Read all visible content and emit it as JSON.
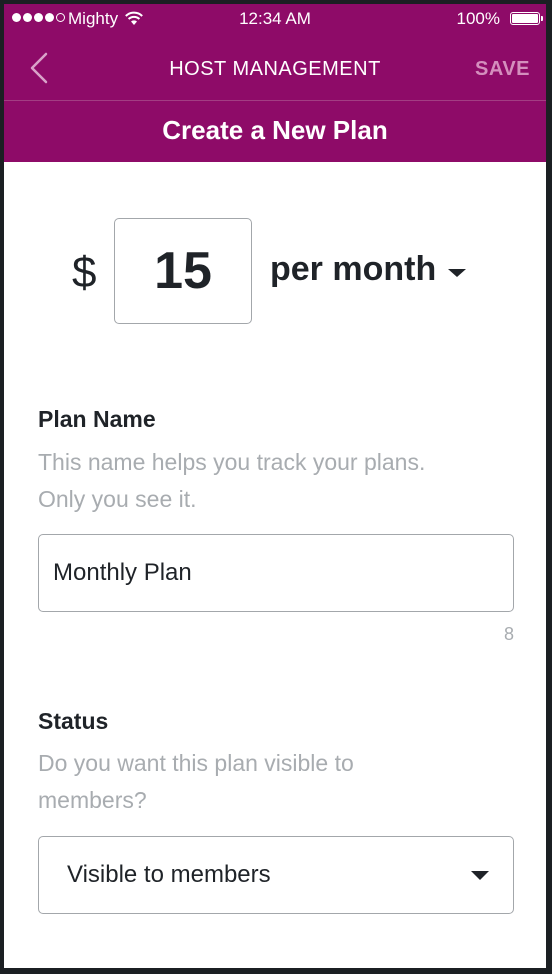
{
  "status_bar": {
    "carrier": "Mighty",
    "time": "12:34 AM",
    "battery": "100%",
    "battery_level": 1.0,
    "signal_bars_filled": 4,
    "signal_bars_total": 5
  },
  "nav": {
    "title": "HOST MANAGEMENT",
    "save_label": "SAVE",
    "back_icon": "chevron-left-icon"
  },
  "header": {
    "title": "Create a New Plan"
  },
  "price": {
    "currency_symbol": "$",
    "amount": "15",
    "period": "per month"
  },
  "plan_name": {
    "label": "Plan Name",
    "help_line1": "This name helps you track your plans.",
    "help_line2": "Only you see it.",
    "value": "Monthly Plan",
    "char_count": "8"
  },
  "status": {
    "label": "Status",
    "help_line1": "Do you want this plan visible to",
    "help_line2": "members?",
    "selected": "Visible to members"
  },
  "colors": {
    "brand": "#8e0b68",
    "save_disabled": "#d48ebd",
    "text": "#1f2328",
    "muted": "#a8acb0",
    "border": "#a3a7ab"
  }
}
